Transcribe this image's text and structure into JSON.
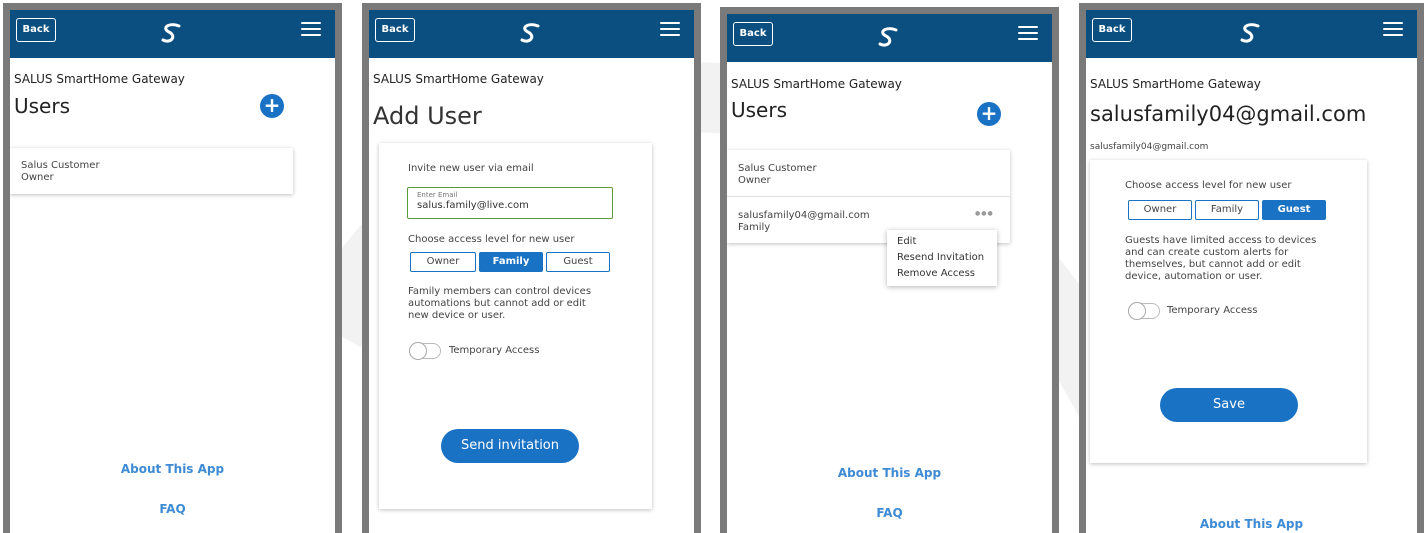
{
  "common": {
    "back_label": "Back",
    "gateway_title": "SALUS SmartHome Gateway",
    "about_link": "About This App",
    "faq_link": "FAQ",
    "plus_glyph": "+"
  },
  "screen1": {
    "title": "Users",
    "users": [
      {
        "name": "Salus Customer",
        "role": "Owner"
      }
    ]
  },
  "screen2": {
    "title": "Add User",
    "invite_label": "Invite new user via email",
    "email_field_label": "Enter Email",
    "email_value": "salus.family@live.com",
    "access_label": "Choose access level for new user",
    "access_options": [
      "Owner",
      "Family",
      "Guest"
    ],
    "access_selected": "Family",
    "description": "Family members can control devices automations but cannot add or edit new device or user.",
    "temporary_access_label": "Temporary Access",
    "send_button": "Send invitation"
  },
  "screen3": {
    "title": "Users",
    "users": [
      {
        "name": "Salus Customer",
        "role": "Owner"
      },
      {
        "name": "salusfamily04@gmail.com",
        "role": "Family"
      }
    ],
    "more_glyph": "●●●",
    "context_menu": [
      "Edit",
      "Resend Invitation",
      "Remove Access"
    ]
  },
  "screen4": {
    "title": "salusfamily04@gmail.com",
    "subtitle": "salusfamily04@gmail.com",
    "access_label": "Choose access level for new user",
    "access_options": [
      "Owner",
      "Family",
      "Guest"
    ],
    "access_selected": "Guest",
    "description": "Guests have limited access to devices and can create custom alerts for themselves, but cannot add or edit device, automation or user.",
    "temporary_access_label": "Temporary Access",
    "save_button": "Save"
  },
  "colors": {
    "header": "#0b4f80",
    "accent": "#1a72c4",
    "link": "#3d8bd4",
    "frame": "#7a7a7a"
  },
  "icons": [
    "back-button",
    "salus-logo-icon",
    "hamburger-menu-icon",
    "add-user-plus-icon",
    "more-dots-icon",
    "toggle-switch"
  ]
}
